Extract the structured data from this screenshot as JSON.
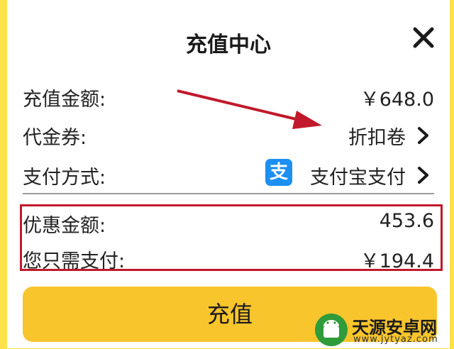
{
  "dialog": {
    "title": "充值中心"
  },
  "rows": {
    "amount": {
      "label": "充值金额:",
      "value": "￥648.0"
    },
    "coupon": {
      "label": "代金券:",
      "value": "折扣卷"
    },
    "payment": {
      "label": "支付方式:",
      "value": "支付宝支付",
      "icon_char": "支"
    }
  },
  "summary": {
    "discount": {
      "label": "优惠金额:",
      "value": "453.6"
    },
    "total": {
      "label": "您只需支付:",
      "value": "￥194.4"
    }
  },
  "button": {
    "label": "充值"
  },
  "watermark": {
    "name": "天源安卓网",
    "url": "www.jytyaz.com"
  },
  "colors": {
    "highlight_border": "#c1192b",
    "button_bg": "#f9c52c",
    "alipay_blue": "#1b8ff2",
    "annotation_arrow": "#c1192b"
  }
}
